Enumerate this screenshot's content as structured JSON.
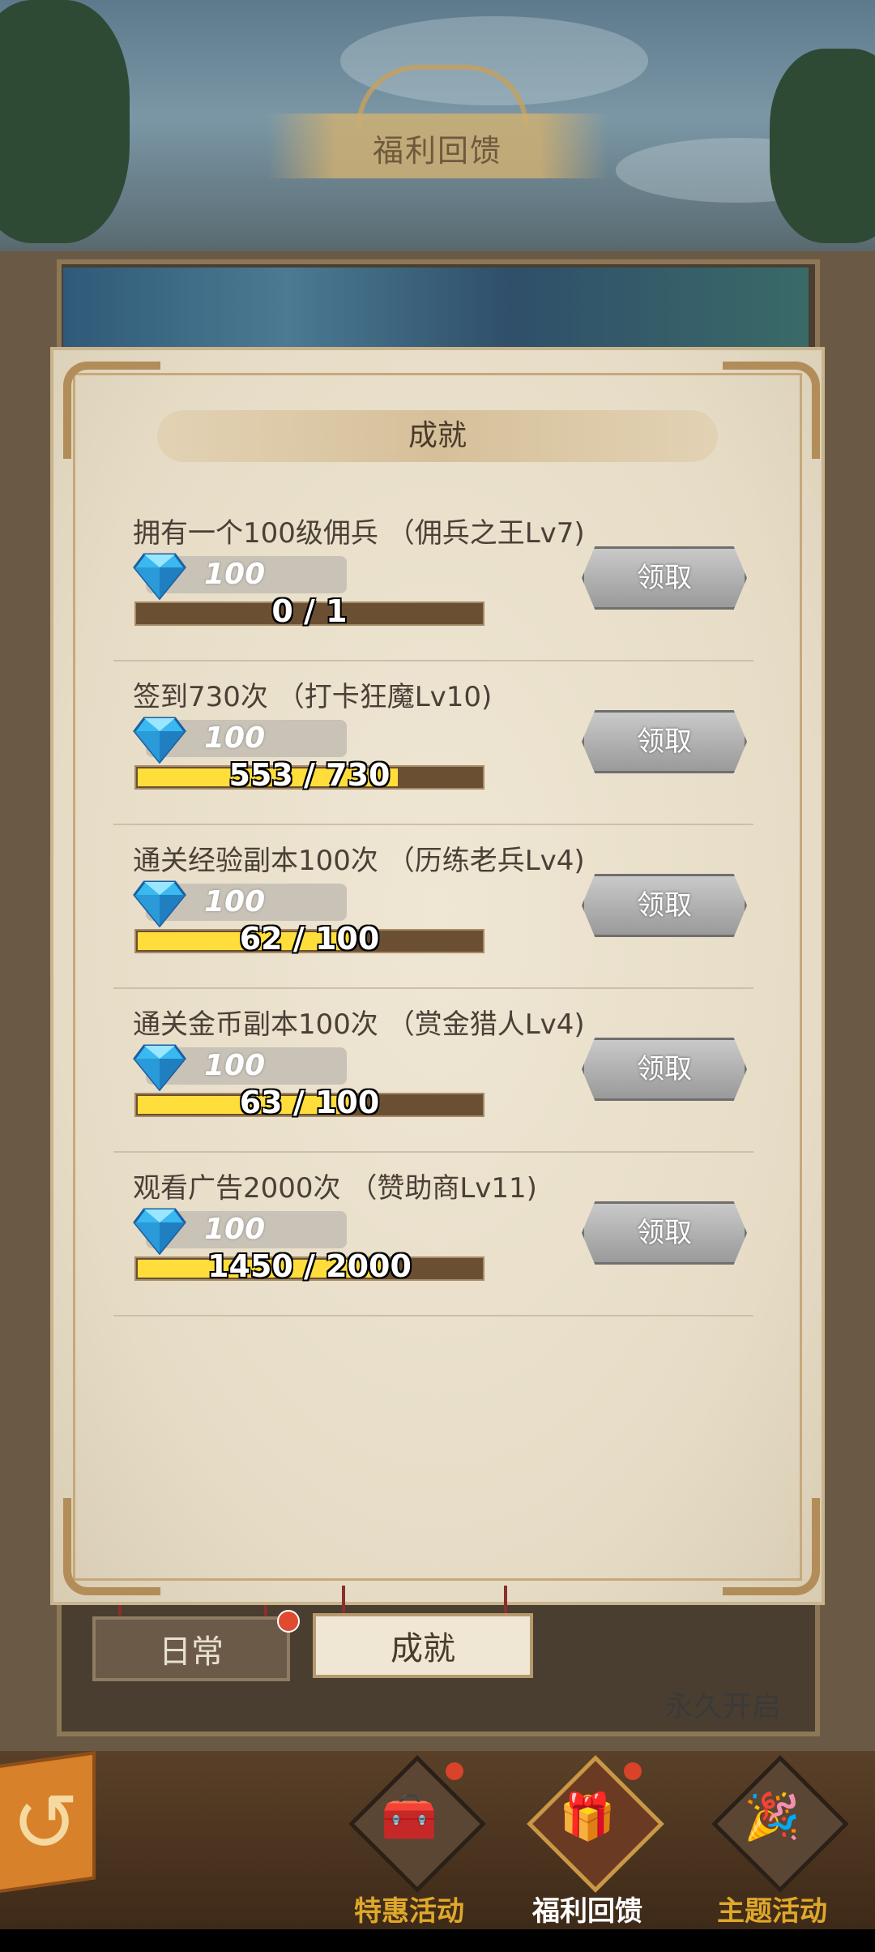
{
  "header": {
    "title": "福利回馈"
  },
  "panel": {
    "section_title": "成就"
  },
  "tasks": [
    {
      "name": "拥有一个100级佣兵 （佣兵之王Lv7)",
      "reward": "100",
      "progress_text": "0 / 1",
      "progress": 0,
      "claim": "领取"
    },
    {
      "name": "签到730次 （打卡狂魔Lv10)",
      "reward": "100",
      "progress_text": "553 / 730",
      "progress": 0.7575,
      "claim": "领取"
    },
    {
      "name": "通关经验副本100次 （历练老兵Lv4)",
      "reward": "100",
      "progress_text": "62 / 100",
      "progress": 0.62,
      "claim": "领取"
    },
    {
      "name": "通关金币副本100次 （赏金猎人Lv4)",
      "reward": "100",
      "progress_text": "63 / 100",
      "progress": 0.63,
      "claim": "领取"
    },
    {
      "name": "观看广告2000次 （赞助商Lv11)",
      "reward": "100",
      "progress_text": "1450 / 2000",
      "progress": 0.725,
      "claim": "领取"
    }
  ],
  "tabs": {
    "daily": "日常",
    "achievement": "成就"
  },
  "footer_note": "永久开启",
  "nav": [
    {
      "label": "特惠活动",
      "icon": "treasure-chest-icon",
      "color": "#e0a82a"
    },
    {
      "label": "福利回馈",
      "icon": "gift-box-icon",
      "color": "#ffffff"
    },
    {
      "label": "主题活动",
      "icon": "party-popper-icon",
      "color": "#e0a82a"
    }
  ],
  "colors": {
    "progress_fill": "#ffde3b",
    "progress_track": "#6b4f33",
    "gem": "#3ab8f0",
    "accent_red": "#e04a2e"
  }
}
